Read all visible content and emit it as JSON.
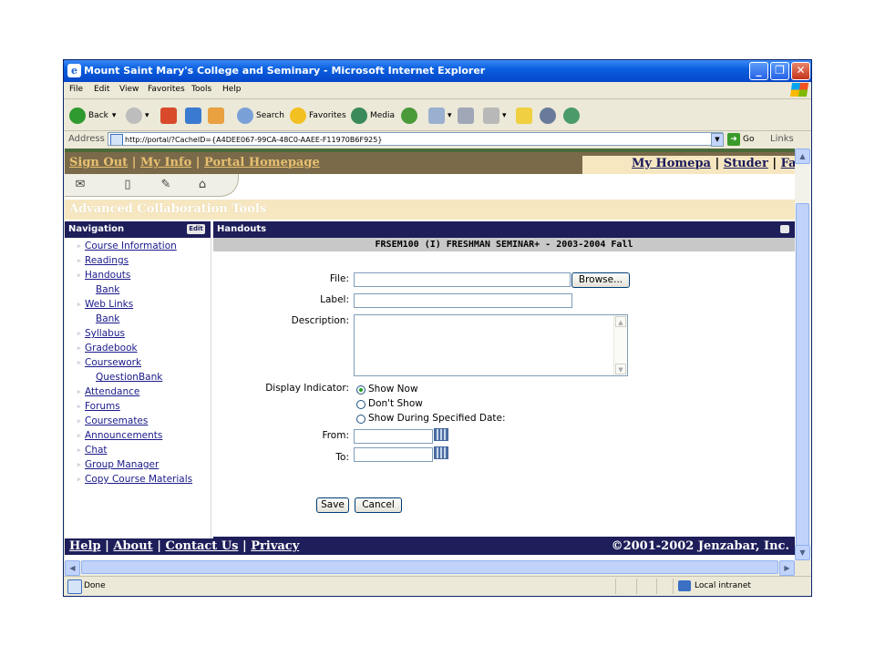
{
  "window": {
    "title": "Mount Saint Mary's College and Seminary - Microsoft Internet Explorer",
    "app_icon": "ie-icon",
    "controls": {
      "minimize": "_",
      "maximize": "❐",
      "close": "✕"
    }
  },
  "menubar": [
    "File",
    "Edit",
    "View",
    "Favorites",
    "Tools",
    "Help"
  ],
  "toolbar": {
    "back": "Back",
    "search": "Search",
    "favorites": "Favorites",
    "media": "Media"
  },
  "address": {
    "label": "Address",
    "url": "http://portal/?CacheID={A4DEE067-99CA-48C0-AAEE-F11970B6F925}",
    "go": "Go",
    "links": "Links"
  },
  "portal": {
    "top_links": [
      "Sign Out",
      "My Info",
      "Portal Homepage"
    ],
    "right_links": [
      "My Homepa",
      "Studer",
      "Faculty"
    ],
    "section_banner": "Advanced Collaboration Tools"
  },
  "navigation": {
    "title": "Navigation",
    "edit": "Edit",
    "items": [
      {
        "label": "Course Information",
        "sub": false
      },
      {
        "label": "Readings",
        "sub": false
      },
      {
        "label": "Handouts",
        "sub": false
      },
      {
        "label": "Bank",
        "sub": true
      },
      {
        "label": "Web Links",
        "sub": false
      },
      {
        "label": "Bank",
        "sub": true
      },
      {
        "label": "Syllabus",
        "sub": false
      },
      {
        "label": "Gradebook",
        "sub": false
      },
      {
        "label": "Coursework",
        "sub": false
      },
      {
        "label": "QuestionBank",
        "sub": true
      },
      {
        "label": "Attendance",
        "sub": false
      },
      {
        "label": "Forums",
        "sub": false
      },
      {
        "label": "Coursemates",
        "sub": false
      },
      {
        "label": "Announcements",
        "sub": false
      },
      {
        "label": "Chat",
        "sub": false
      },
      {
        "label": "Group Manager",
        "sub": false
      },
      {
        "label": "Copy Course Materials",
        "sub": false
      }
    ]
  },
  "main": {
    "title": "Handouts",
    "course": "FRSEM100 (I) FRESHMAN SEMINAR+ - 2003-2004 Fall",
    "form": {
      "file_label": "File:",
      "browse": "Browse...",
      "label_label": "Label:",
      "description_label": "Description:",
      "display_label": "Display Indicator:",
      "options": [
        "Show Now",
        "Don't Show",
        "Show During Specified Date:"
      ],
      "selected_option": "Show Now",
      "from_label": "From:",
      "to_label": "To:",
      "save": "Save",
      "cancel": "Cancel"
    }
  },
  "footer": {
    "links": [
      "Help",
      "About",
      "Contact Us",
      "Privacy"
    ],
    "copyright": "©2001-2002 Jenzabar, Inc."
  },
  "status": {
    "text": "Done",
    "zone": "Local intranet"
  }
}
